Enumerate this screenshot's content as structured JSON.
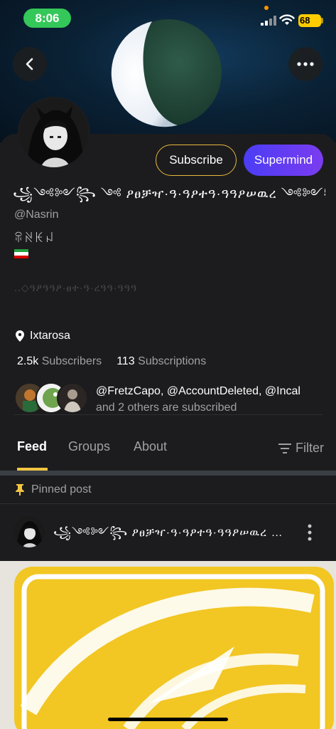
{
  "status_bar": {
    "time": "8:06",
    "battery": "68",
    "colors": {
      "time_pill": "#34c759",
      "battery": "#ffcc00",
      "recording_dot": "#ff9500"
    }
  },
  "header": {
    "back_icon": "chevron-left-icon",
    "more_icon": "more-horizontal-icon"
  },
  "profile": {
    "display_name": "꧁༺༻꧂ ༺ ዖፀቻዣ·ዓ·ዓዖተዓ·ዓዓዖሠዉረ ༺༻꧂ ꧁",
    "username": "@Nasrin",
    "bio": "ꋖꋊꀘꈤ",
    "flag": "iran-flag",
    "faded_line": "..◇ዓዖዓዓዖ·ፀተ·ዓ·ረዓዓ·ዓዓዓ",
    "location": "Ixtarosa",
    "subscribers_count": "2.5k",
    "subscribers_label": "Subscribers",
    "subscriptions_count": "113",
    "subscriptions_label": "Subscriptions",
    "mutual_subscribers": "@FretzCapo, @AccountDeleted, @Incal",
    "mutual_others": "and 2 others are subscribed"
  },
  "actions": {
    "subscribe_label": "Subscribe",
    "supermind_label": "Supermind",
    "colors": {
      "subscribe_border": "#e7b93d",
      "supermind_start": "#4b3df5",
      "supermind_end": "#7b3cf0"
    }
  },
  "tabs": {
    "items": [
      {
        "label": "Feed",
        "active": true
      },
      {
        "label": "Groups",
        "active": false
      },
      {
        "label": "About",
        "active": false
      }
    ],
    "filter_label": "Filter",
    "accent": "#f5c542"
  },
  "feed": {
    "pinned_label": "Pinned post",
    "post_title": "꧁༺༻꧂ ዖፀቻዣ·ዓ·ዓዖተዓ·ዓዓዖሠዉረ ༺༻꧂..."
  }
}
